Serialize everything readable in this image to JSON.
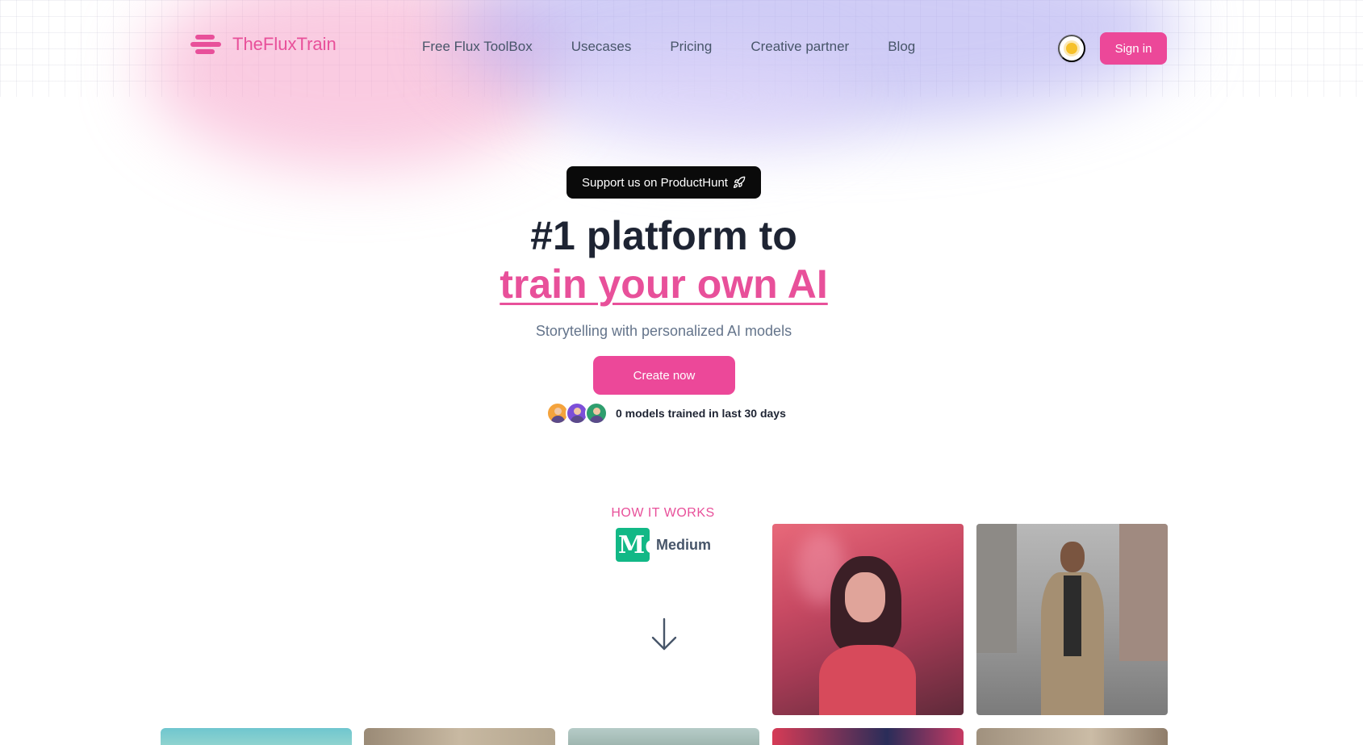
{
  "brand": {
    "name": "TheFluxTrain",
    "accent_color": "#ec4899"
  },
  "nav": {
    "items": [
      {
        "label": "Free Flux ToolBox"
      },
      {
        "label": "Usecases"
      },
      {
        "label": "Pricing"
      },
      {
        "label": "Creative partner"
      },
      {
        "label": "Blog"
      }
    ]
  },
  "header": {
    "theme_icon": "sun-icon",
    "signin_label": "Sign in"
  },
  "hero": {
    "badge": "Support us on ProductHunt",
    "badge_icon": "rocket-icon",
    "title_line1": "#1 platform to",
    "title_line2": "train your own AI",
    "subtitle": "Storytelling with personalized AI models",
    "cta_label": "Create now",
    "social_proof": "0 models trained in last 30 days"
  },
  "how_it_works": {
    "label": "HOW IT WORKS",
    "badge_logo_text": "Me",
    "badge_label": "Medium"
  }
}
